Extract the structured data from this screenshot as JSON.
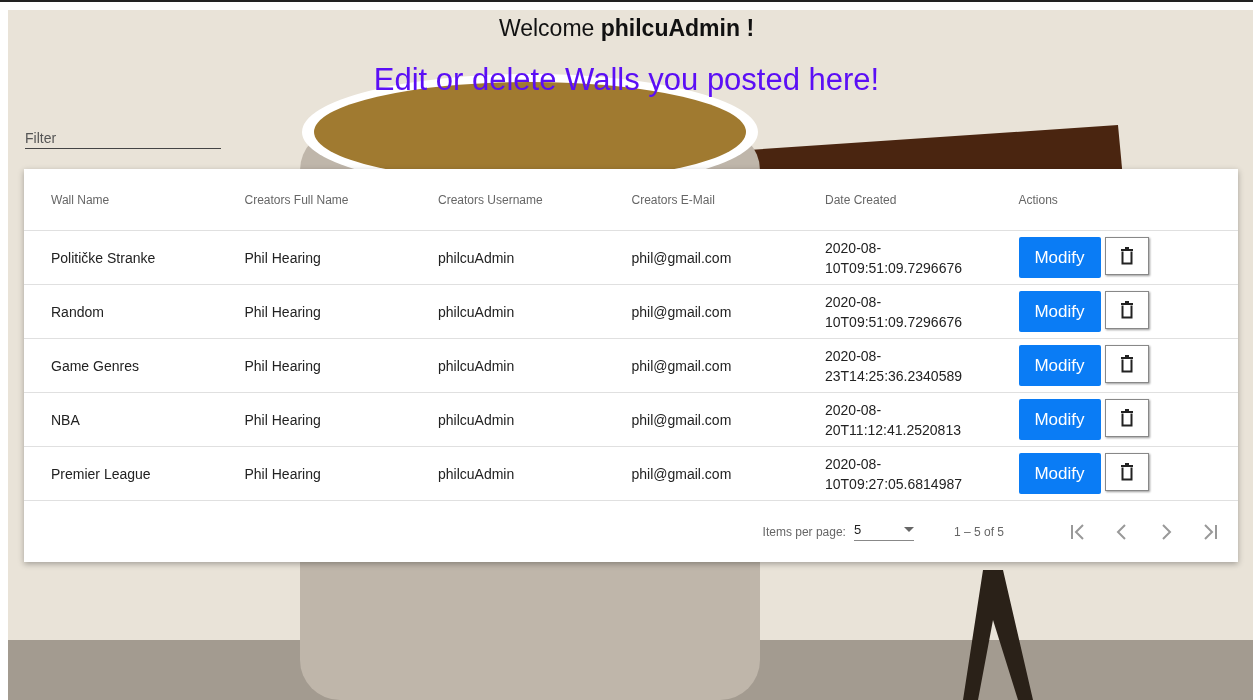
{
  "welcome": {
    "prefix": "Welcome",
    "username": "philcuAdmin",
    "suffix": "!"
  },
  "heading": "Edit or delete Walls you posted here!",
  "filter": {
    "placeholder": "Filter"
  },
  "table": {
    "columns": [
      "Wall Name",
      "Creators Full Name",
      "Creators Username",
      "Creators E-Mail",
      "Date Created",
      "Actions"
    ],
    "rows": [
      {
        "cells": [
          "Političke Stranke",
          "Phil Hearing",
          "philcuAdmin",
          "phil@gmail.com",
          "2020-08-10T09:51:09.7296676"
        ],
        "action": "Modify"
      },
      {
        "cells": [
          "Random",
          "Phil Hearing",
          "philcuAdmin",
          "phil@gmail.com",
          "2020-08-10T09:51:09.7296676"
        ],
        "action": "Modify"
      },
      {
        "cells": [
          "Game Genres",
          "Phil Hearing",
          "philcuAdmin",
          "phil@gmail.com",
          "2020-08-23T14:25:36.2340589"
        ],
        "action": "Modify"
      },
      {
        "cells": [
          "NBA",
          "Phil Hearing",
          "philcuAdmin",
          "phil@gmail.com",
          "2020-08-20T11:12:41.2520813"
        ],
        "action": "Modify"
      },
      {
        "cells": [
          "Premier League",
          "Phil Hearing",
          "philcuAdmin",
          "phil@gmail.com",
          "2020-08-10T09:27:05.6814987"
        ],
        "action": "Modify"
      }
    ]
  },
  "paginator": {
    "label": "Items per page:",
    "page_size": "5",
    "range": "1 – 5 of 5"
  }
}
